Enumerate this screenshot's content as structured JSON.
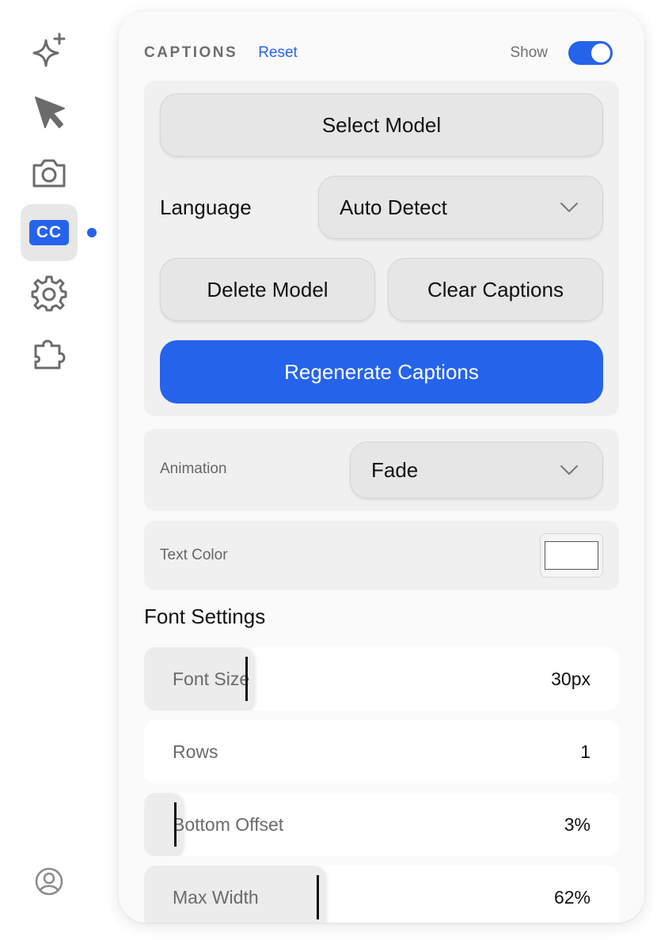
{
  "sidebar": {
    "items": [
      {
        "icon": "sparkle-icon"
      },
      {
        "icon": "cursor-arrow-icon"
      },
      {
        "icon": "camera-icon"
      },
      {
        "icon": "cc-captions-icon",
        "label": "CC",
        "active": true
      },
      {
        "icon": "gear-icon"
      },
      {
        "icon": "puzzle-icon"
      }
    ],
    "footer_icon": "user-account-icon"
  },
  "panel": {
    "title": "CAPTIONS",
    "reset_label": "Reset",
    "show_label": "Show",
    "show_enabled": true
  },
  "model": {
    "select_model_label": "Select Model",
    "language_label": "Language",
    "language_value": "Auto Detect",
    "delete_model_label": "Delete Model",
    "clear_captions_label": "Clear Captions",
    "regenerate_label": "Regenerate Captions"
  },
  "animation": {
    "label": "Animation",
    "value": "Fade"
  },
  "text_color": {
    "label": "Text Color",
    "value": "#ffffff"
  },
  "font_settings": {
    "title": "Font Settings",
    "sliders": [
      {
        "label": "Font Size",
        "value": "30px",
        "fraction": 0.23
      },
      {
        "label": "Rows",
        "value": "1",
        "fraction": 0.0
      },
      {
        "label": "Bottom Offset",
        "value": "3%",
        "fraction": 0.08
      },
      {
        "label": "Max Width",
        "value": "62%",
        "fraction": 0.38
      }
    ]
  },
  "colors": {
    "accent": "#2563eb",
    "panel_bg": "#fafafa",
    "card_bg": "#f0f0f0"
  }
}
